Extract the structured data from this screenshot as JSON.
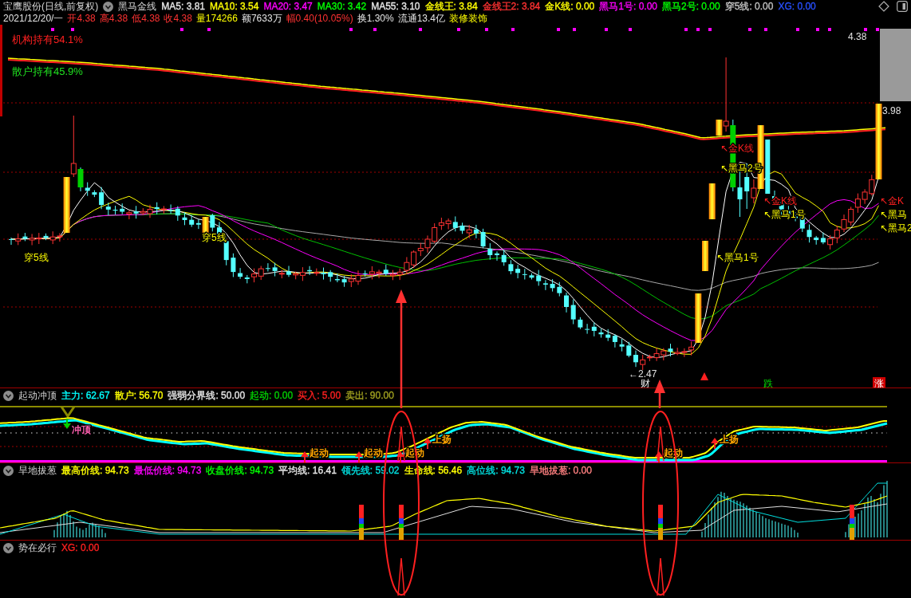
{
  "header": {
    "title": "宝鹰股份(日线,前复权)",
    "indicator": "黑马金线",
    "values": [
      {
        "text": "MA5: 3.81",
        "color": "#e6e6e6"
      },
      {
        "text": "MA10: 3.54",
        "color": "#ffff00"
      },
      {
        "text": "MA20: 3.47",
        "color": "#ff00ff"
      },
      {
        "text": "MA30: 3.42",
        "color": "#00ff00"
      },
      {
        "text": "MA55: 3.10",
        "color": "#e6e6e6"
      },
      {
        "text": "金线王: 3.84",
        "color": "#ffff00"
      },
      {
        "text": "金线王2: 3.84",
        "color": "#ff3232"
      },
      {
        "text": "金K线: 0.00",
        "color": "#ffff00"
      },
      {
        "text": "黑马1号: 0.00",
        "color": "#ff00ff"
      },
      {
        "text": "黑马2号: 0.00",
        "color": "#00ff00"
      },
      {
        "text": "穿5线: 0.00",
        "color": "#c0c0c0"
      },
      {
        "text": "XG: 0.00",
        "color": "#2850ff"
      }
    ]
  },
  "quote": [
    {
      "text": "2021/12/20/一",
      "color": "#e6e6e6"
    },
    {
      "text": "开4.38",
      "color": "#ff3232"
    },
    {
      "text": "高4.38",
      "color": "#ff3232"
    },
    {
      "text": "低4.38",
      "color": "#ff3232"
    },
    {
      "text": "收4.38",
      "color": "#ff3232"
    },
    {
      "text": "量174266",
      "color": "#ffff00"
    },
    {
      "text": "额7633万",
      "color": "#e6e6e6"
    },
    {
      "text": "幅0.40(10.05%)",
      "color": "#ff3232"
    },
    {
      "text": "换1.30%",
      "color": "#e6e6e6"
    },
    {
      "text": "流通13.4亿",
      "color": "#e6e6e6"
    },
    {
      "text": "装修装饰",
      "color": "#ffff00"
    }
  ],
  "main_chart": {
    "holdings": [
      {
        "text": "机构持有54.1%",
        "color": "#ff2020"
      },
      {
        "text": "散户持有45.9%",
        "color": "#20e020"
      }
    ],
    "signals": [
      {
        "text": "↖金K线",
        "color": "#ff2020"
      },
      {
        "text": "↖黑马2号",
        "color": "#ffff00"
      },
      {
        "text": "↖金K线",
        "color": "#ff2020"
      },
      {
        "text": "↖金K",
        "color": "#ff2020"
      },
      {
        "text": "↖黑马1号",
        "color": "#ffff00"
      },
      {
        "text": "↖黑马",
        "color": "#ffff00"
      },
      {
        "text": "↖黑马2",
        "color": "#ffff00"
      },
      {
        "text": "穿5线",
        "color": "#ffff00"
      },
      {
        "text": "穿5线",
        "color": "#ffff00"
      },
      {
        "text": "↖黑马1号",
        "color": "#ffff00"
      }
    ],
    "axis_labels": [
      "4.38",
      "3.98"
    ],
    "low_label": "←2.47",
    "markers": [
      {
        "text": "财",
        "kind": "plain"
      },
      {
        "text": "跌",
        "kind": "down"
      },
      {
        "text": "涨",
        "kind": "up"
      }
    ]
  },
  "panels": [
    {
      "title": "起动冲顶",
      "kind": "oscillator",
      "values": [
        {
          "text": "主力: 62.67",
          "color": "#00ffff"
        },
        {
          "text": "散户: 56.70",
          "color": "#ffff00"
        },
        {
          "text": "强弱分界线: 50.00",
          "color": "#e6e6e6"
        },
        {
          "text": "起动: 0.00",
          "color": "#00d000"
        },
        {
          "text": "买入: 5.00",
          "color": "#ff2020"
        },
        {
          "text": "卖出: 90.00",
          "color": "#a0a020"
        }
      ],
      "labels": [
        {
          "text": "冲顶",
          "kind": "down",
          "color": "#ff60b0"
        },
        {
          "text": "上扬",
          "kind": "up",
          "color": "#ffa500"
        },
        {
          "text": "上扬",
          "kind": "up",
          "color": "#ffa500"
        },
        {
          "text": "起动",
          "kind": "up",
          "color": "#ffa500"
        },
        {
          "text": "起动",
          "kind": "up",
          "color": "#ffa500"
        },
        {
          "text": "起动",
          "kind": "up",
          "color": "#ffa500"
        },
        {
          "text": "起动",
          "kind": "up",
          "color": "#ffa500"
        }
      ]
    },
    {
      "title": "旱地拔葱",
      "kind": "histogram",
      "values": [
        {
          "text": "最高价线: 94.73",
          "color": "#ffff00"
        },
        {
          "text": "最低价线: 94.73",
          "color": "#ff00ff"
        },
        {
          "text": "收盘价线: 94.73",
          "color": "#00ff00"
        },
        {
          "text": "平均线: 16.41",
          "color": "#e6e6e6"
        },
        {
          "text": "领先线: 59.02",
          "color": "#00e0e0"
        },
        {
          "text": "生命线: 56.46",
          "color": "#ffff00"
        },
        {
          "text": "高位线: 94.73",
          "color": "#00e0e0"
        },
        {
          "text": "旱地拔葱: 0.00",
          "color": "#ff8080"
        }
      ]
    },
    {
      "title": "势在必行",
      "kind": "signal",
      "values": [
        {
          "text": "XG: 0.00",
          "color": "#ff2020"
        }
      ]
    }
  ]
}
